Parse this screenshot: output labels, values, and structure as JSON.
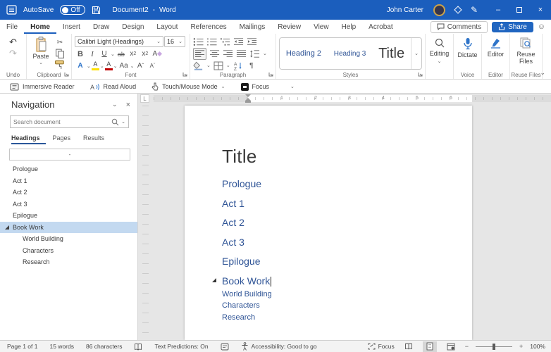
{
  "colors": {
    "titlebar_blue": "#1B5EBD",
    "accent_blue": "#185ABD",
    "heading_text_blue": "#2F5496",
    "nav_selection_blue": "#C3D9F0",
    "share_button_blue": "#2065C0",
    "highlight_yellow": "#FFE100",
    "font_color_red": "#C00000"
  },
  "icons": {
    "chevron_down": "⌄",
    "close": "×",
    "minimize": "–",
    "pen": "✎",
    "smiley": "☺",
    "scissors": "✂",
    "pilcrow": "¶",
    "undo": "↶",
    "redo": "↷",
    "bold": "B",
    "italic": "I",
    "underline": "U",
    "strikethrough": "ab",
    "script_base": "x",
    "script_sub": "2",
    "script_sup": "2",
    "clear_format": "A",
    "text_effects": "A",
    "highlight_letter": "A",
    "font_color_letter": "A",
    "change_case": "Aa",
    "grow_font": "A",
    "grow_caret": "ˆ",
    "shrink_font": "A",
    "shrink_caret": "ˇ",
    "tab_selector": "L",
    "zoom_out": "−",
    "zoom_in": "+"
  },
  "titlebar": {
    "autosave_label": "AutoSave",
    "autosave_state": "Off",
    "document_title": "Document2",
    "separator": "-",
    "app_name": "Word",
    "user_name": "John Carter"
  },
  "tab_row": {
    "tabs": [
      "File",
      "Home",
      "Insert",
      "Draw",
      "Design",
      "Layout",
      "References",
      "Mailings",
      "Review",
      "View",
      "Help",
      "Acrobat"
    ],
    "active_tab": "Home",
    "comments_label": "Comments",
    "share_label": "Share"
  },
  "ribbon": {
    "undo": {
      "label": "Undo"
    },
    "clipboard": {
      "label": "Clipboard",
      "paste_label": "Paste"
    },
    "font": {
      "label": "Font",
      "font_name": "Calibri Light (Headings)",
      "font_size": "16"
    },
    "paragraph": {
      "label": "Paragraph"
    },
    "styles": {
      "label": "Styles",
      "items": [
        "Heading 2",
        "Heading 3",
        "Title"
      ]
    },
    "editing": {
      "label": "Editing"
    },
    "voice": {
      "label": "Voice",
      "button_label": "Dictate"
    },
    "editor": {
      "label": "Editor",
      "button_label": "Editor"
    },
    "reuse_files": {
      "label": "Reuse Files",
      "button_label": "Reuse Files"
    }
  },
  "quick_access": {
    "items": [
      "Immersive Reader",
      "Read Aloud",
      "Touch/Mouse Mode",
      "Focus"
    ]
  },
  "navigation": {
    "title": "Navigation",
    "search_placeholder": "Search document",
    "tabs": [
      "Headings",
      "Pages",
      "Results"
    ],
    "active_tab": "Headings",
    "edit_box_text": "-",
    "items": [
      {
        "label": "Prologue",
        "level": 0,
        "selected": false
      },
      {
        "label": "Act 1",
        "level": 0,
        "selected": false
      },
      {
        "label": "Act 2",
        "level": 0,
        "selected": false
      },
      {
        "label": "Act 3",
        "level": 0,
        "selected": false
      },
      {
        "label": "Epilogue",
        "level": 0,
        "selected": false
      },
      {
        "label": "Book Work",
        "level": 0,
        "selected": true
      },
      {
        "label": "World Building",
        "level": 1,
        "selected": false
      },
      {
        "label": "Characters",
        "level": 1,
        "selected": false
      },
      {
        "label": "Research",
        "level": 1,
        "selected": false
      }
    ]
  },
  "document": {
    "title": "Title",
    "headings": [
      "Prologue",
      "Act 1",
      "Act 2",
      "Act 3",
      "Epilogue",
      "Book Work"
    ],
    "collapsed_heading": "Book Work",
    "subheadings": [
      "World Building",
      "Characters",
      "Research"
    ],
    "ruler_numbers": [
      "1",
      "2",
      "3",
      "4",
      "5",
      "6"
    ]
  },
  "statusbar": {
    "page_info": "Page 1 of 1",
    "word_count": "15 words",
    "char_count": "86 characters",
    "text_predictions": "Text Predictions: On",
    "accessibility": "Accessibility: Good to go",
    "focus_label": "Focus",
    "zoom_level": "100%"
  }
}
